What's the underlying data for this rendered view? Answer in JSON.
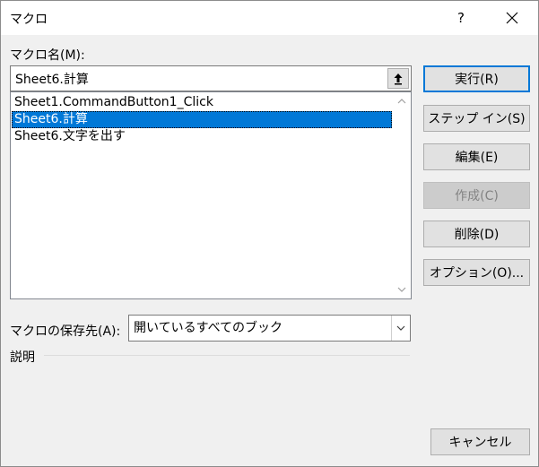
{
  "window": {
    "title": "マクロ",
    "help_label": "?"
  },
  "macro_name": {
    "label": "マクロ名(M):",
    "value": "Sheet6.計算"
  },
  "macro_list": {
    "items": [
      {
        "label": "Sheet1.CommandButton1_Click",
        "selected": false
      },
      {
        "label": "Sheet6.計算",
        "selected": true
      },
      {
        "label": "Sheet6.文字を出す",
        "selected": false
      }
    ]
  },
  "buttons": {
    "run": "実行(R)",
    "step_in": "ステップ イン(S)",
    "edit": "編集(E)",
    "create": "作成(C)",
    "delete": "削除(D)",
    "options": "オプション(O)...",
    "cancel": "キャンセル"
  },
  "location": {
    "label": "マクロの保存先(A):",
    "value": "開いているすべてのブック"
  },
  "description": {
    "label": "説明"
  },
  "colors": {
    "selection": "#0078d7",
    "dialog_background": "#f0f0f0"
  },
  "icons": {
    "close": "close-icon",
    "upload": "upload-arrow-icon",
    "scroll_up": "chevron-up-icon",
    "scroll_down": "chevron-down-icon",
    "dropdown": "chevron-down-icon"
  }
}
